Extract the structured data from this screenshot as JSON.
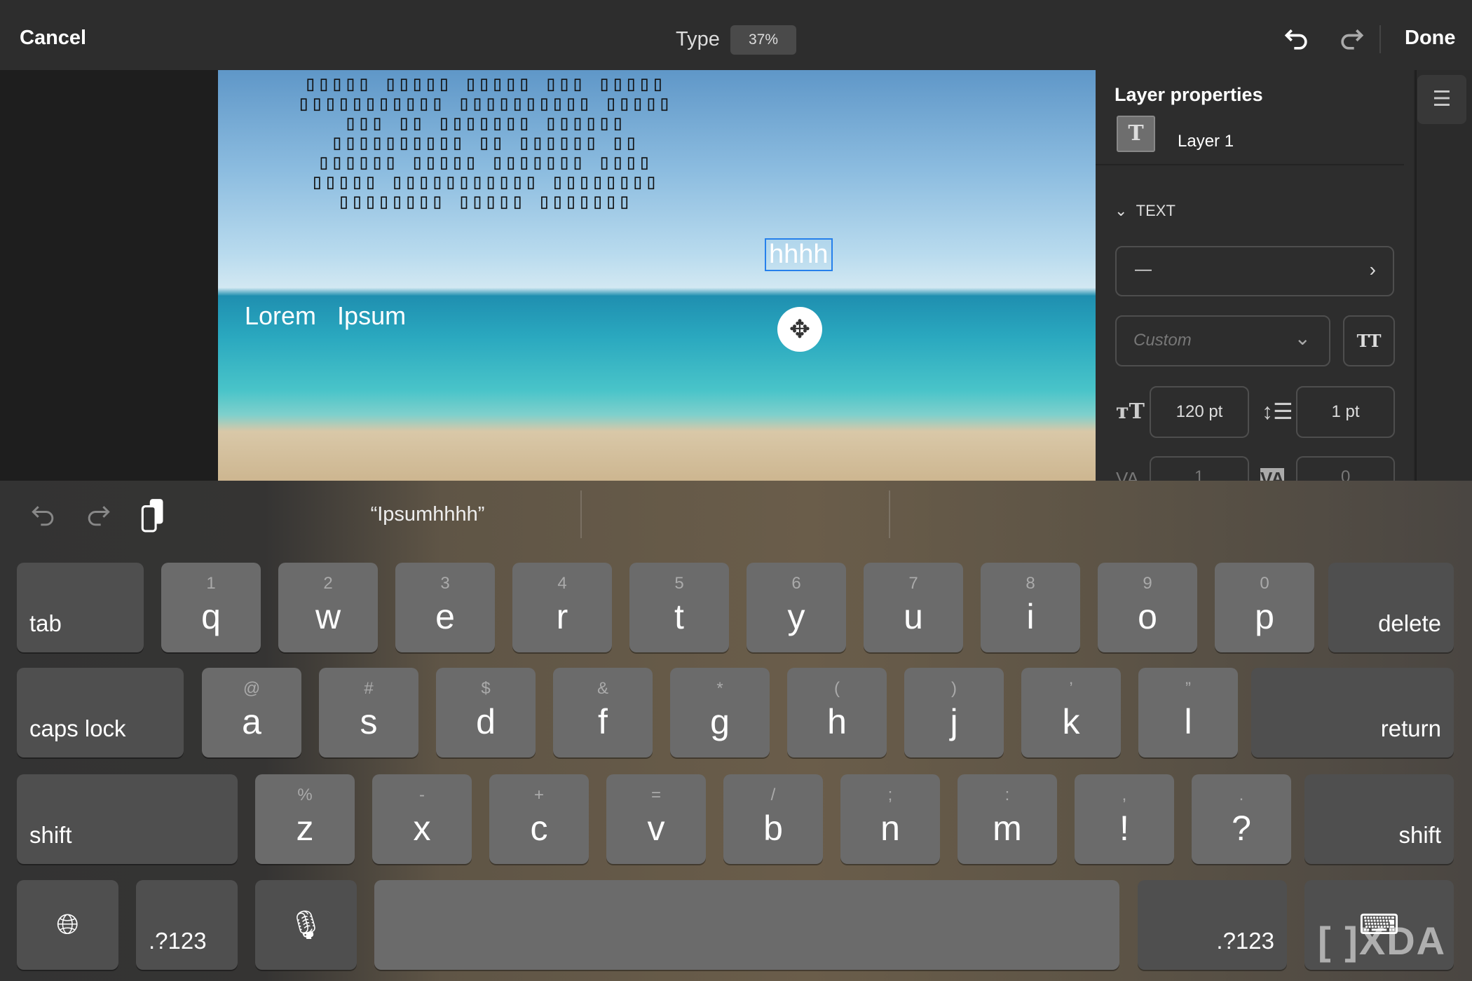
{
  "topbar": {
    "cancel": "Cancel",
    "mode": "Type",
    "zoom": "37%",
    "done": "Done"
  },
  "canvas": {
    "tofu_lines": [
      "▯▯▯▯▯ ▯▯▯▯▯ ▯▯▯▯▯ ▯▯▯ ▯▯▯▯▯",
      "▯▯▯▯▯▯▯▯▯▯▯ ▯▯▯▯▯▯▯▯▯▯ ▯▯▯▯▯",
      "▯▯▯ ▯▯ ▯▯▯▯▯▯▯ ▯▯▯▯▯▯",
      "▯▯▯▯▯▯▯▯▯▯ ▯▯ ▯▯▯▯▯▯ ▯▯",
      "▯▯▯▯▯▯ ▯▯▯▯▯ ▯▯▯▯▯▯▯ ▯▯▯▯",
      "▯▯▯▯▯ ▯▯▯▯▯▯▯▯▯▯▯ ▯▯▯▯▯▯▯▯",
      "▯▯▯▯▯▯▯▯ ▯▯▯▯▯ ▯▯▯▯▯▯▯"
    ],
    "lorem": "Lorem Ipsum",
    "editing_text": "hhhh"
  },
  "panel": {
    "title": "Layer properties",
    "layer_name": "Layer 1",
    "section": "TEXT",
    "font": "—",
    "style_placeholder": "Custom",
    "size": "120 pt",
    "leading": "1 pt",
    "tracking": "1",
    "kerning": "0"
  },
  "keyboard": {
    "suggestion": "“Ipsumhhhh”",
    "row1": [
      [
        "tab",
        ""
      ],
      [
        "q",
        "1"
      ],
      [
        "w",
        "2"
      ],
      [
        "e",
        "3"
      ],
      [
        "r",
        "4"
      ],
      [
        "t",
        "5"
      ],
      [
        "y",
        "6"
      ],
      [
        "u",
        "7"
      ],
      [
        "i",
        "8"
      ],
      [
        "o",
        "9"
      ],
      [
        "p",
        "0"
      ],
      [
        "delete",
        ""
      ]
    ],
    "row2": [
      [
        "caps lock",
        ""
      ],
      [
        "a",
        "@"
      ],
      [
        "s",
        "#"
      ],
      [
        "d",
        "$"
      ],
      [
        "f",
        "&"
      ],
      [
        "g",
        "*"
      ],
      [
        "h",
        "("
      ],
      [
        "j",
        ")"
      ],
      [
        "k",
        "’"
      ],
      [
        "l",
        "”"
      ],
      [
        "return",
        ""
      ]
    ],
    "row3": [
      [
        "shift",
        ""
      ],
      [
        "z",
        "%"
      ],
      [
        "x",
        "-"
      ],
      [
        "c",
        "+"
      ],
      [
        "v",
        "="
      ],
      [
        "b",
        "/"
      ],
      [
        "n",
        ";"
      ],
      [
        "m",
        ":"
      ],
      [
        "!",
        ","
      ],
      [
        "?",
        "."
      ],
      [
        "shift",
        ""
      ]
    ],
    "numbers_label": ".?123"
  },
  "watermark": "XDA",
  "colors": {
    "accent": "#2680eb",
    "topbar": "#2d2d2d",
    "key": "#6b6b6b"
  }
}
